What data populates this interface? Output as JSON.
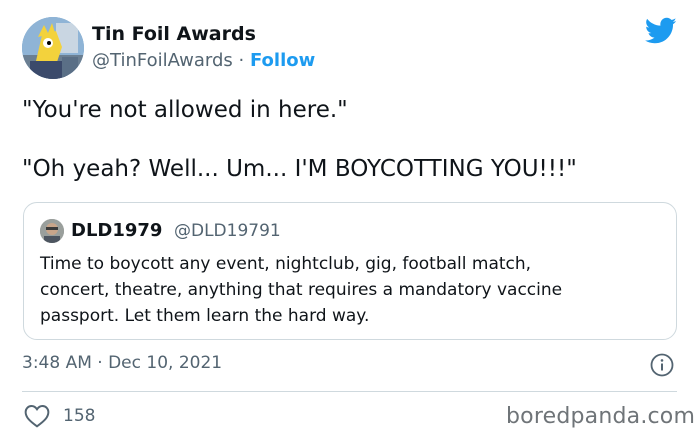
{
  "author": {
    "name": "Tin Foil Awards",
    "handle": "@TinFoilAwards",
    "separator": " · ",
    "follow_label": "Follow"
  },
  "tweet": {
    "line1": "\"You're not allowed in here.\"",
    "line2": "\"Oh yeah?  Well...  Um...  I'M BOYCOTTING YOU!!!\""
  },
  "quoted": {
    "name": "DLD1979",
    "handle": "@DLD19791",
    "lines": [
      "Time to boycott any event, nightclub, gig, football match,",
      "concert, theatre, anything that requires a mandatory vaccine",
      "passport. Let them learn the hard way."
    ]
  },
  "footer": {
    "timestamp": "3:48 AM · Dec 10, 2021",
    "likes": "158"
  },
  "watermark": "boredpanda.com",
  "colors": {
    "accent": "#1d9bf0",
    "muted": "#536471",
    "border": "#cfd9de"
  },
  "icons": [
    "twitter-bird-icon",
    "info-icon",
    "heart-icon"
  ]
}
